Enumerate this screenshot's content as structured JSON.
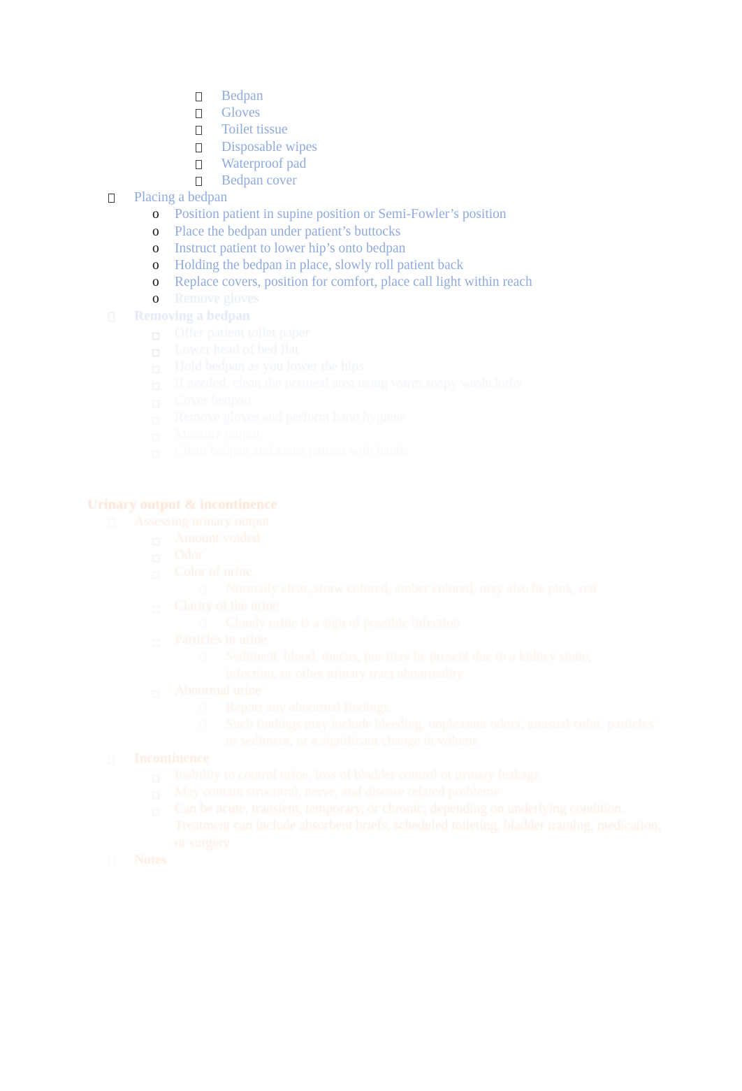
{
  "document": {
    "type": "study-notes",
    "colors": {
      "primary_text_blue": "#8FA ADC",
      "blue": "#8FAADC",
      "orange": "#ED7D31",
      "marker_black": "#111111",
      "background": "#FFFFFF"
    }
  },
  "supplies": {
    "items": [
      "Bedpan",
      "Gloves",
      "Toilet tissue",
      "Disposable wipes",
      "Waterproof pad",
      "Bedpan cover"
    ]
  },
  "placing_a_bedpan": {
    "heading": "Placing a bedpan",
    "steps": [
      "Position patient in supine position or Semi-Fowler’s position",
      "Place the bedpan under patient’s buttocks",
      "Instruct patient to lower hip’s onto bedpan",
      "Holding the bedpan in place, slowly roll patient back",
      "Replace covers, position for comfort, place call light within reach",
      "Remove gloves"
    ]
  },
  "removing_a_bedpan": {
    "heading": "Removing a bedpan",
    "steps": [
      "Offer patient toilet paper",
      "Lower head of bed flat",
      "Hold bedpan as you lower the hips",
      "If needed, clean the perineal area using warm soapy washcloths",
      "Cover bedpan",
      "Remove gloves and perform hand hygiene",
      "Measure output",
      "Clean bedpan and assist patient with hands"
    ]
  },
  "urinary_section": {
    "heading": "Urinary output & incontinence",
    "subheading": "Assessing urinary output",
    "items": [
      {
        "label": "Amount voided",
        "sub": []
      },
      {
        "label": "Odor",
        "sub": []
      },
      {
        "label": "Color of urine",
        "sub": [
          "Normally clear, straw colored, amber colored, may also be pink, red"
        ]
      },
      {
        "label": "Clarity of the urine",
        "sub": [
          "Cloudy urine is a sign of possible infection"
        ]
      },
      {
        "label": "Particles in urine",
        "sub": [
          "Sediment, blood, mucus, pus may be present due to a kidney stone, infection, or other urinary tract abnormality"
        ]
      },
      {
        "label": "Abnormal urine",
        "sub": [
          "Report any abnormal findings",
          "Such findings may include bleeding, unpleasant odors, unusual color, particles or sediment, or a significant change in volume"
        ]
      }
    ]
  },
  "incontinence_section": {
    "heading": "Incontinence",
    "items": [
      "Inability to control urine, loss of bladder control or urinary leakage",
      "May contain structural, nerve, and disease related problems",
      "Can be acute, transient, temporary, or chronic; depending on underlying condition. Treatment can include absorbent briefs, scheduled toileting, bladder training, medication, or surgery"
    ]
  },
  "final_section": {
    "heading": "Notes"
  }
}
